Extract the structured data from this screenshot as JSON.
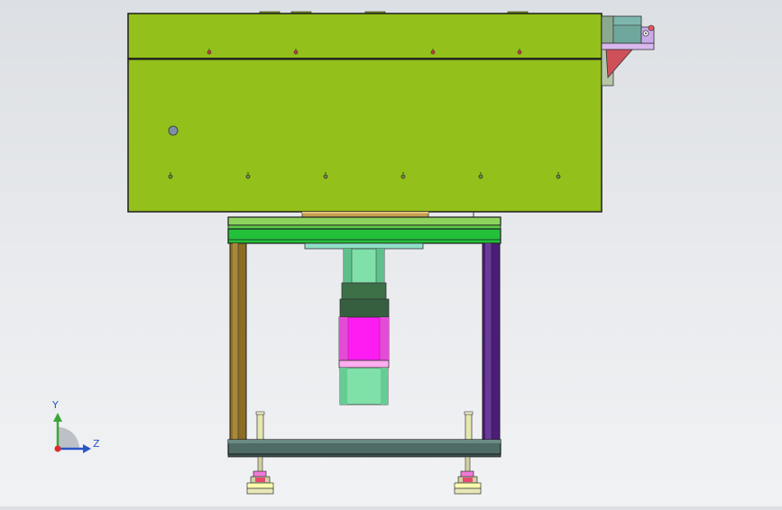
{
  "colors": {
    "background_top": "#dcdfe3",
    "housing": "#93c01a",
    "outline": "#1e1e1e",
    "top_plate": "#8ed35e",
    "top_plate_band": "#23c03a",
    "base_plate": "#4e6b66",
    "left_post": "#8c6d25",
    "right_post": "#4c1d78",
    "motor_coupling": "#7fe0a8",
    "motor_body": "#ff1cf2",
    "motor_gearbox": "#3e7048",
    "leveling_feet": "#e6e6b8",
    "bracket_red": "#d0505a",
    "triad_y": "#3aa63a",
    "triad_z": "#2b55c8"
  },
  "triad": {
    "y_label": "Y",
    "z_label": "Z"
  }
}
